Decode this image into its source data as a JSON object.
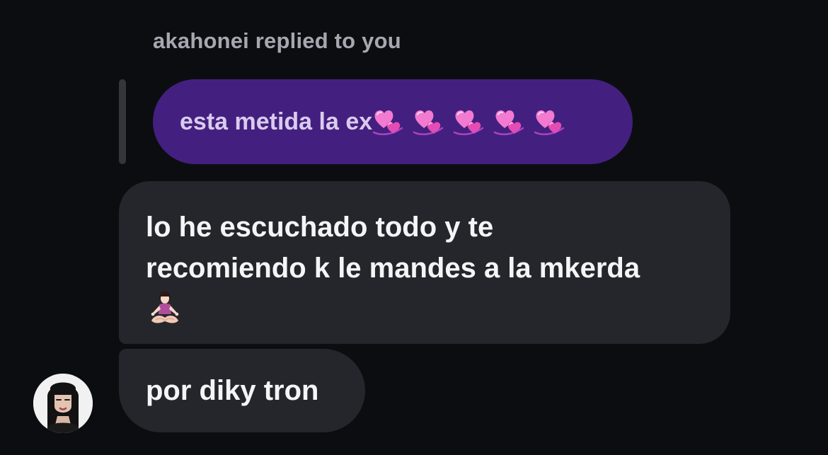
{
  "reply_header": {
    "text": "akahonei replied to you"
  },
  "quoted_message": {
    "text": "esta metida la ex",
    "emojis": [
      "revolving-hearts",
      "revolving-hearts",
      "revolving-hearts",
      "revolving-hearts",
      "revolving-hearts"
    ],
    "bubble_color": "#43207f"
  },
  "messages": [
    {
      "lines": [
        "lo he escuchado todo y te",
        "recomiendo k le mandes a la mkerda"
      ],
      "emoji": "person-in-lotus-position"
    },
    {
      "text": "por diky tron"
    }
  ],
  "sender": {
    "avatar_icon": "avatar-portrait"
  },
  "colors": {
    "background": "#0c0d11",
    "incoming_bubble": "#24262b",
    "reply_label": "#a6a8b0"
  }
}
